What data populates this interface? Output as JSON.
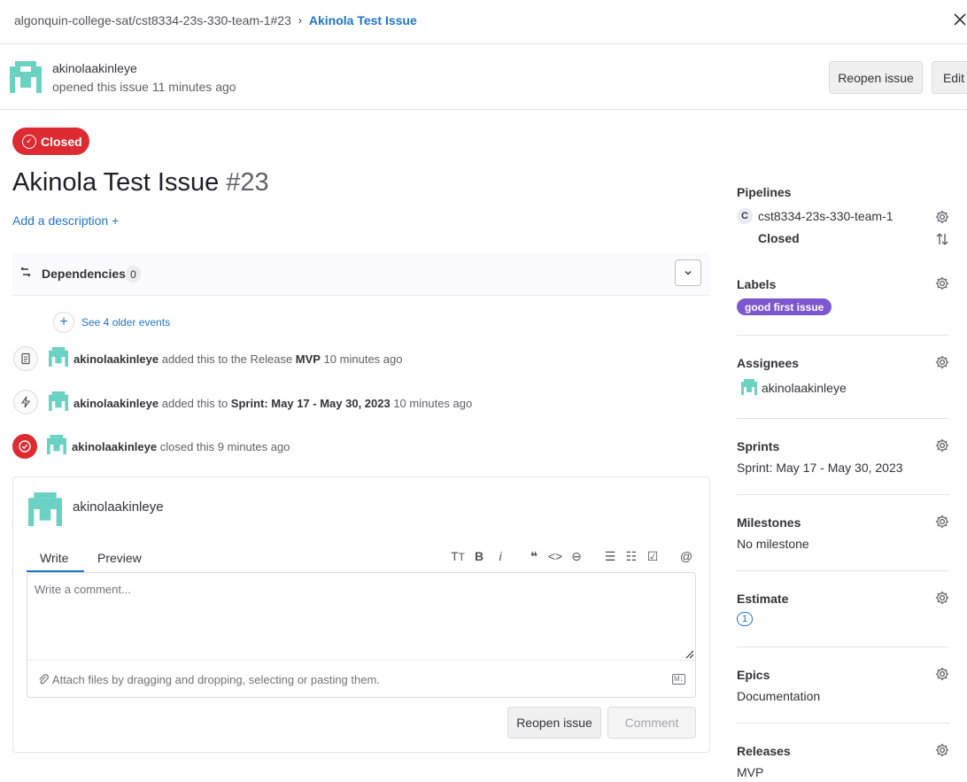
{
  "breadcrumb": {
    "path": "algonquin-college-sat/cst8334-23s-330-team-1#23",
    "separator": "›",
    "current": "Akinola Test Issue"
  },
  "header": {
    "author": "akinolaakinleye",
    "opened_text": "opened this issue 11 minutes ago",
    "reopen_label": "Reopen issue",
    "edit_label": "Edit"
  },
  "issue": {
    "status": "Closed",
    "title": "Akinola Test Issue",
    "number": "#23",
    "add_description": "Add a description +"
  },
  "dependencies": {
    "label": "Dependencies",
    "count": "0"
  },
  "timeline": {
    "older_events": "See 4 older events",
    "events": [
      {
        "user": "akinolaakinleye",
        "pre": " added this to the Release ",
        "target": "MVP",
        "time": " 10 minutes ago"
      },
      {
        "user": "akinolaakinleye",
        "pre": " added this to ",
        "target": "Sprint: May 17 - May 30, 2023",
        "time": " 10 minutes ago"
      },
      {
        "user": "akinolaakinleye",
        "pre": " closed this 9 minutes ago",
        "target": "",
        "time": ""
      }
    ]
  },
  "comment": {
    "author": "akinolaakinleye",
    "tab_write": "Write",
    "tab_preview": "Preview",
    "placeholder": "Write a comment...",
    "attach_text": "Attach files by dragging and dropping, selecting or pasting them.",
    "markdown_badge": "M↓",
    "reopen_label": "Reopen issue",
    "comment_label": "Comment"
  },
  "sidebar": {
    "pipelines": {
      "heading": "Pipelines",
      "badge": "C",
      "project": "cst8334-23s-330-team-1",
      "status": "Closed"
    },
    "labels": {
      "heading": "Labels",
      "value": "good first issue",
      "color": "#7b58cf"
    },
    "assignees": {
      "heading": "Assignees",
      "value": "akinolaakinleye"
    },
    "sprints": {
      "heading": "Sprints",
      "value": "Sprint: May 17 - May 30, 2023"
    },
    "milestones": {
      "heading": "Milestones",
      "value": "No milestone"
    },
    "estimate": {
      "heading": "Estimate",
      "value": "1"
    },
    "epics": {
      "heading": "Epics",
      "value": "Documentation"
    },
    "releases": {
      "heading": "Releases",
      "value": "MVP"
    }
  },
  "colors": {
    "accent": "#1f75cb",
    "closed": "#dd2b31",
    "avatar": "#6ad2c2"
  }
}
